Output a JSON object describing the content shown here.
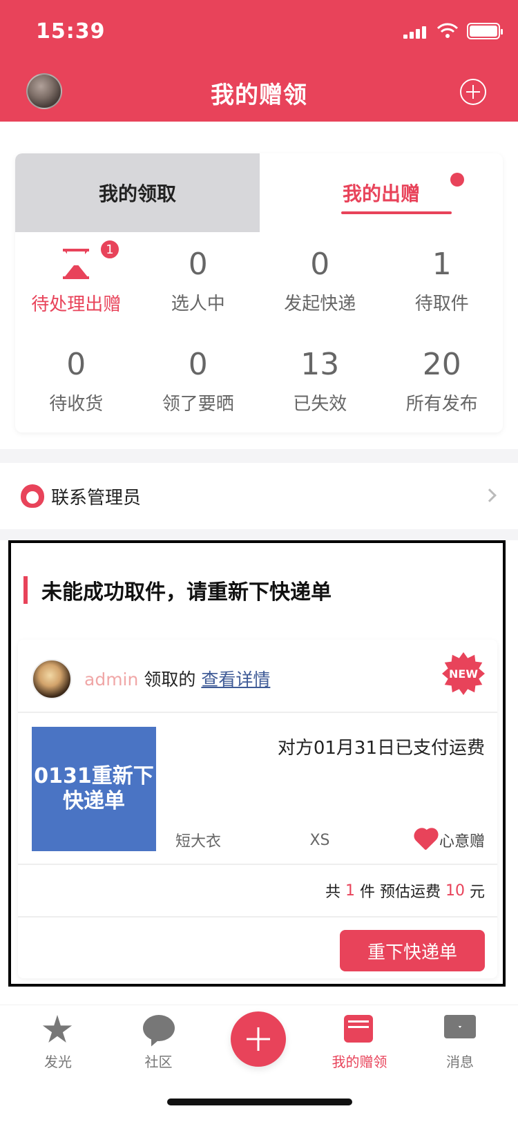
{
  "status_bar": {
    "time": "15:39",
    "icons": [
      "signal-icon",
      "wifi-icon",
      "battery-icon"
    ]
  },
  "header": {
    "title": "我的赠领",
    "left_avatar": "user-avatar",
    "right_icon": "plus-circle-icon"
  },
  "tabs": {
    "left_label": "我的领取",
    "right_label": "我的出赠",
    "right_has_dot": true
  },
  "stats": [
    {
      "id": "pending",
      "label": "待处理出赠",
      "icon": "hourglass-icon",
      "badge": "1",
      "active": true
    },
    {
      "id": "selecting",
      "value": "0",
      "label": "选人中"
    },
    {
      "id": "ship",
      "value": "0",
      "label": "发起快递"
    },
    {
      "id": "pickup",
      "value": "1",
      "label": "待取件"
    },
    {
      "id": "receive",
      "value": "0",
      "label": "待收货"
    },
    {
      "id": "showoff",
      "value": "0",
      "label": "领了要晒"
    },
    {
      "id": "expired",
      "value": "13",
      "label": "已失效"
    },
    {
      "id": "all",
      "value": "20",
      "label": "所有发布"
    }
  ],
  "admin_row": {
    "label": "联系管理员",
    "icon": "admin-icon",
    "chevron": "chevron-right-icon"
  },
  "failed_section": {
    "title": "未能成功取件，请重新下快递单",
    "order": {
      "user": "admin",
      "action_text": "领取的",
      "link_text": "查看详情",
      "new_badge": "NEW",
      "thumb_text": "0131重新下快递单",
      "paid_text": "对方01月31日已支付运费",
      "item_name": "短大衣",
      "size": "XS",
      "gift_label": "心意赠",
      "total": {
        "prefix": "共",
        "count": "1",
        "mid": "件 预估运费",
        "fee": "10",
        "suffix": "元"
      },
      "button_label": "重下快递单"
    }
  },
  "tabbar": [
    {
      "label": "发光",
      "icon": "star-icon"
    },
    {
      "label": "社区",
      "icon": "chat-bubbles-icon"
    },
    {
      "label": "",
      "icon": "plus-icon"
    },
    {
      "label": "我的赠领",
      "icon": "gift-book-icon",
      "active": true
    },
    {
      "label": "消息",
      "icon": "mail-icon"
    }
  ],
  "colors": {
    "brand": "#e8435a",
    "thumb": "#4a74c4",
    "link": "#3e5a96"
  }
}
